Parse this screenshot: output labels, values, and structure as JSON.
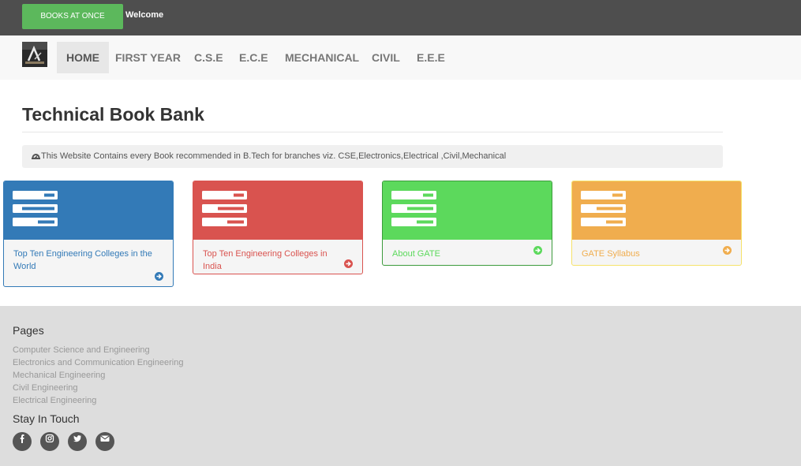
{
  "topbar": {
    "brand_label": "BOOKS AT ONCE",
    "welcome_text": "Welcome"
  },
  "nav": {
    "items": [
      {
        "label": "HOME",
        "active": true
      },
      {
        "label": "FIRST YEAR",
        "active": false
      },
      {
        "label": "C.S.E",
        "active": false
      },
      {
        "label": "E.C.E",
        "active": false
      },
      {
        "label": "MECHANICAL",
        "active": false
      },
      {
        "label": "CIVIL",
        "active": false
      },
      {
        "label": "E.E.E",
        "active": false
      }
    ]
  },
  "main": {
    "title": "Technical Book Bank",
    "info_text": "This Website Contains every Book recommended in B.Tech for branches viz. CSE,Electronics,Electrical ,Civil,Mechanical"
  },
  "panels": [
    {
      "label": "Top Ten Engineering Colleges in the World",
      "icon": "tasks-icon",
      "color": "#337ab7"
    },
    {
      "label": "Top Ten Engineering Colleges in India",
      "icon": "tasks-icon",
      "color": "#d9534f"
    },
    {
      "label": "About GATE",
      "icon": "tasks-icon",
      "color": "#5cd95c"
    },
    {
      "label": "GATE Syllabus",
      "icon": "tasks-icon",
      "color": "#f0ad4e"
    }
  ],
  "footer": {
    "pages_heading": "Pages",
    "links": [
      "Computer Science and Engineering",
      "Electronics and Communication Engineering",
      "Mechanical Engineering",
      "Civil Engineering",
      "Electrical Engineering"
    ],
    "social_heading": "Stay In Touch",
    "social_icons": [
      "facebook-icon",
      "instagram-icon",
      "twitter-icon",
      "envelope-icon"
    ]
  }
}
